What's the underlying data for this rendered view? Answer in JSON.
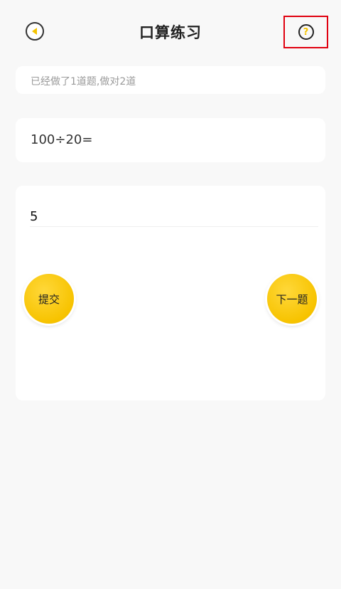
{
  "header": {
    "title": "口算练习",
    "back_icon": "back-circle-icon",
    "help_icon": "question-circle-icon",
    "help_icon_glyph": "?",
    "accent_color": "#f5c400"
  },
  "progress": {
    "text": "已经做了1道题,做对2道"
  },
  "question": {
    "expression": "100÷20="
  },
  "answer": {
    "value": "5"
  },
  "buttons": {
    "submit_label": "提交",
    "next_label": "下一题",
    "color": "#f7c300"
  }
}
